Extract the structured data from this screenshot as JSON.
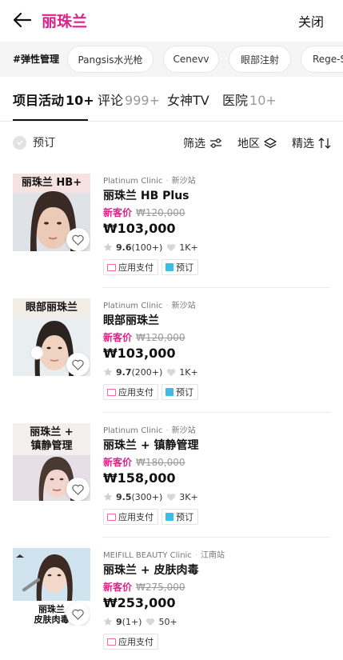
{
  "header": {
    "title": "丽珠兰",
    "close_label": "关闭",
    "back_icon": "arrow-left-icon"
  },
  "tagbar": {
    "active": "#弹性管理",
    "chips": [
      "Pangsis水光枪",
      "Cenevv",
      "眼部注射",
      "Rege-S"
    ]
  },
  "tabs": [
    {
      "label": "项目活动",
      "count": "10+"
    },
    {
      "label": "评论",
      "count": "999+"
    },
    {
      "label": "女神TV",
      "count": ""
    },
    {
      "label": "医院",
      "count": "10+"
    }
  ],
  "filters": {
    "reserve_label": "预订",
    "filter_label": "筛选",
    "region_label": "地区",
    "sort_label": "精选"
  },
  "products": [
    {
      "image_caption": "丽珠兰 HB+",
      "clinic": "Platinum Clinic",
      "station": "新沙站",
      "name": "丽珠兰 HB Plus",
      "new_label": "新客价",
      "original_price": "₩120,000",
      "price": "₩103,000",
      "rating": "9.6",
      "reviews": "(100+)",
      "likes": "1K+",
      "badges": [
        "应用支付",
        "预订"
      ]
    },
    {
      "image_caption": "眼部丽珠兰",
      "clinic": "Platinum Clinic",
      "station": "新沙站",
      "name": "眼部丽珠兰",
      "new_label": "新客价",
      "original_price": "₩120,000",
      "price": "₩103,000",
      "rating": "9.7",
      "reviews": "(200+)",
      "likes": "1K+",
      "badges": [
        "应用支付",
        "预订"
      ]
    },
    {
      "image_caption": "丽珠兰 +\n镇静管理",
      "clinic": "Platinum Clinic",
      "station": "新沙站",
      "name": "丽珠兰 + 镇静管理",
      "new_label": "新客价",
      "original_price": "₩180,000",
      "price": "₩158,000",
      "rating": "9.5",
      "reviews": "(300+)",
      "likes": "3K+",
      "badges": [
        "应用支付",
        "预订"
      ]
    },
    {
      "image_caption": "丽珠兰\n皮肤肉毒",
      "clinic": "MEIFILL BEAUTY Clinic",
      "station": "江南站",
      "name": "丽珠兰 + 皮肤肉毒",
      "new_label": "新客价",
      "original_price": "₩275,000",
      "price": "₩253,000",
      "rating": "9",
      "reviews": "(1+)",
      "likes": "50+",
      "badges": [
        "应用支付"
      ]
    }
  ],
  "colors": {
    "accent": "#e0218a",
    "booking_icon": "#3bbde6",
    "pay_icon": "#f06b9d"
  }
}
